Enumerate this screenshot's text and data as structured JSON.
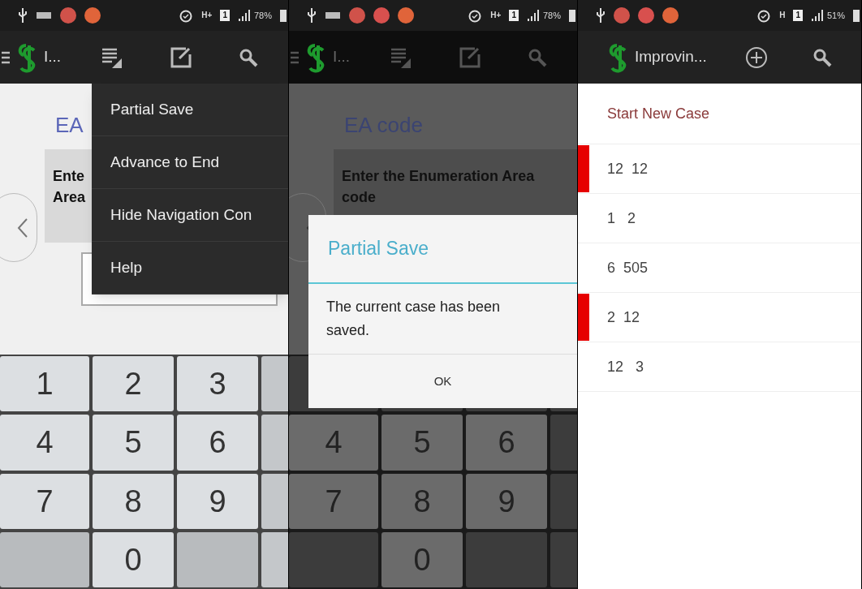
{
  "screens": [
    {
      "status_bar": {
        "notifications": [
          {
            "color": "#d0524a"
          },
          {
            "color": "#e0643a"
          }
        ],
        "keyboard_icon": true,
        "network": "H+",
        "sim": "1",
        "battery": "78%"
      },
      "action_bar": {
        "menu_icon": true,
        "title": "I...",
        "actions": [
          {
            "kind": "overflow"
          },
          {
            "kind": "edit"
          },
          {
            "kind": "search"
          }
        ]
      },
      "dimmed": false,
      "form": {
        "title": "EA",
        "question": "Ente Area"
      },
      "menu": {
        "items": [
          "Partial Save",
          "Advance to End",
          "Hide Navigation Con",
          "Help"
        ]
      },
      "keyboard": [
        [
          {
            "kind": "digit",
            "label": "1"
          },
          {
            "kind": "digit",
            "label": "2"
          },
          {
            "kind": "digit",
            "label": "3"
          }
        ],
        [
          {
            "kind": "digit",
            "label": "4"
          },
          {
            "kind": "digit",
            "label": "5"
          },
          {
            "kind": "digit",
            "label": "6"
          }
        ],
        [
          {
            "kind": "digit",
            "label": "7"
          },
          {
            "kind": "digit",
            "label": "8"
          },
          {
            "kind": "digit",
            "label": "9"
          }
        ],
        [
          {
            "kind": "blank"
          },
          {
            "kind": "digit",
            "label": "0"
          },
          {
            "kind": "blank"
          }
        ]
      ]
    },
    {
      "status_bar": {
        "notifications": [
          {
            "color": "#d0524a"
          },
          {
            "color": "#d8504e"
          },
          {
            "color": "#e0643a"
          }
        ],
        "keyboard_icon": true,
        "network": "H+",
        "sim": "1",
        "battery": "78%"
      },
      "action_bar": {
        "menu_icon": true,
        "title": "I...",
        "actions": [
          {
            "kind": "overflow"
          },
          {
            "kind": "edit"
          },
          {
            "kind": "search"
          }
        ]
      },
      "dimmed": true,
      "form": {
        "title": "EA code",
        "question": "Enter the Enumeration Area code"
      },
      "dialog": {
        "title": "Partial Save",
        "message": "The current case has been saved.",
        "button": "OK"
      },
      "keyboard": [
        [
          {
            "kind": "blank"
          },
          {
            "kind": "blank"
          },
          {
            "kind": "blank"
          }
        ],
        [
          {
            "kind": "digit",
            "label": "4"
          },
          {
            "kind": "digit",
            "label": "5"
          },
          {
            "kind": "digit",
            "label": "6"
          }
        ],
        [
          {
            "kind": "digit",
            "label": "7"
          },
          {
            "kind": "digit",
            "label": "8"
          },
          {
            "kind": "digit",
            "label": "9"
          }
        ],
        [
          {
            "kind": "blank"
          },
          {
            "kind": "digit",
            "label": "0"
          },
          {
            "kind": "blank"
          }
        ]
      ]
    },
    {
      "status_bar": {
        "notifications": [
          {
            "color": "#d0524a"
          },
          {
            "color": "#d8504e"
          },
          {
            "color": "#e0643a"
          }
        ],
        "keyboard_icon": false,
        "network": "H",
        "sim": "1",
        "battery": "51%"
      },
      "action_bar": {
        "menu_icon": false,
        "title": "Improvin...",
        "actions": [
          {
            "kind": "add"
          },
          {
            "kind": "search"
          }
        ]
      },
      "dimmed": false,
      "case_list": {
        "new_case": "Start New Case",
        "cases": [
          {
            "label": "12  12",
            "flagged": true
          },
          {
            "label": "1   2",
            "flagged": false
          },
          {
            "label": "6  505",
            "flagged": false
          },
          {
            "label": "2  12",
            "flagged": true
          },
          {
            "label": "12   3",
            "flagged": false
          }
        ]
      }
    }
  ]
}
